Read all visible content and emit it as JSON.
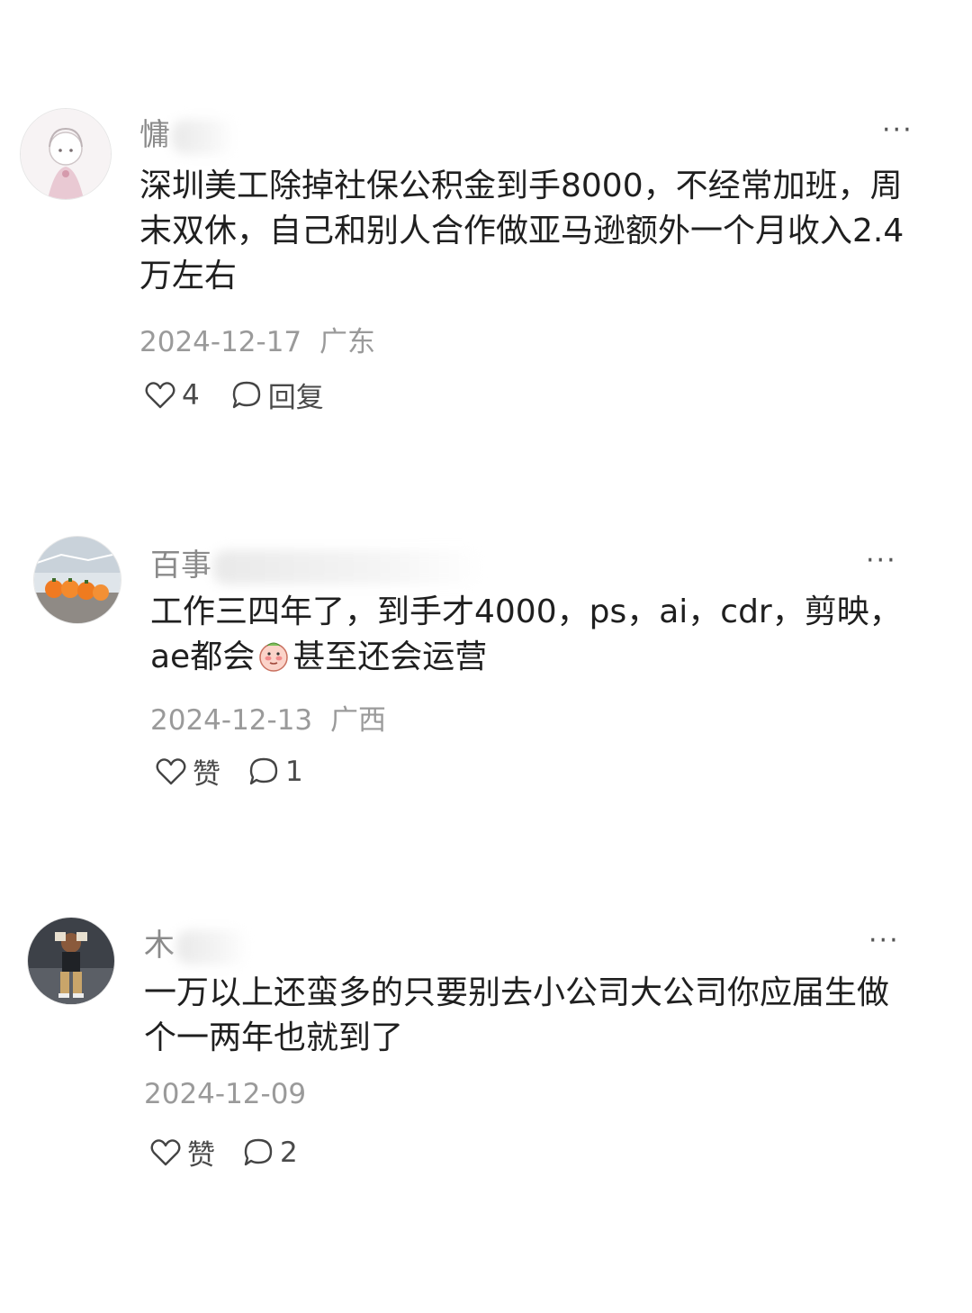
{
  "comments": [
    {
      "username_visible": "慵",
      "text": "深圳美工除掉社保公积金到手8000，不经常加班，周末双休，自己和别人合作做亚马逊额外一个月收入2.4万左右",
      "date": "2024-12-17",
      "location": "广东",
      "like_count": "4",
      "reply_label": "回复",
      "more_label": "···"
    },
    {
      "username_visible": "百事",
      "text_before_emoji": "工作三四年了，到手才4000，ps，ai，cdr，剪映，ae都会",
      "text_after_emoji": "甚至还会运营",
      "date": "2024-12-13",
      "location": "广西",
      "like_label": "赞",
      "reply_count": "1",
      "more_label": "···"
    },
    {
      "username_visible": "木",
      "text": "一万以上还蛮多的只要别去小公司大公司你应届生做个一两年也就到了",
      "date": "2024-12-09",
      "like_label": "赞",
      "reply_count": "2",
      "more_label": "···"
    }
  ]
}
